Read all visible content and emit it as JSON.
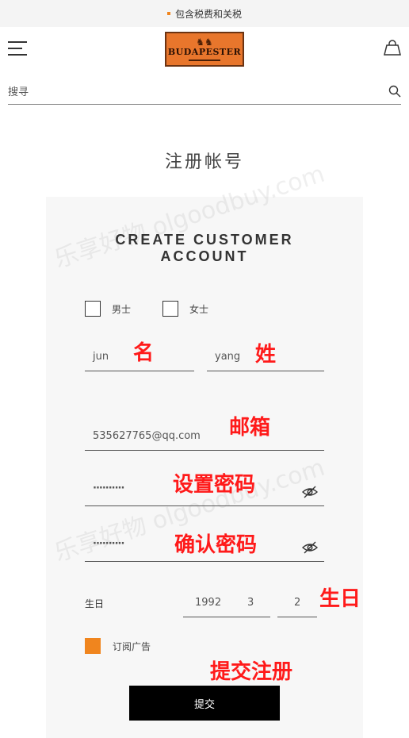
{
  "topbar": {
    "text": "包含税费和关税",
    "accent": "#f0851e"
  },
  "header": {
    "logo_text": "BUDAPESTER",
    "logo_crest": "♞♞"
  },
  "search": {
    "placeholder": "搜寻"
  },
  "page": {
    "title": "注册帐号"
  },
  "form": {
    "title_line1": "CREATE CUSTOMER",
    "title_line2": "ACCOUNT",
    "gender_male": "男士",
    "gender_female": "女士",
    "first_name": "jun",
    "last_name": "yang",
    "email": "535627765@qq.com",
    "password": "··········",
    "confirm_password": "··········",
    "birth_label": "生日",
    "birth_year": "1992",
    "birth_month": "3",
    "birth_day": "2",
    "newsletter_label": "订阅广告",
    "newsletter_checked": true,
    "submit_label": "提交"
  },
  "annotations": {
    "first_name": "名",
    "last_name": "姓",
    "email": "邮箱",
    "password": "设置密码",
    "confirm_password": "确认密码",
    "birthday": "生日",
    "submit": "提交注册"
  },
  "watermark": {
    "text": "乐享好物 olgoodbuy.com"
  }
}
